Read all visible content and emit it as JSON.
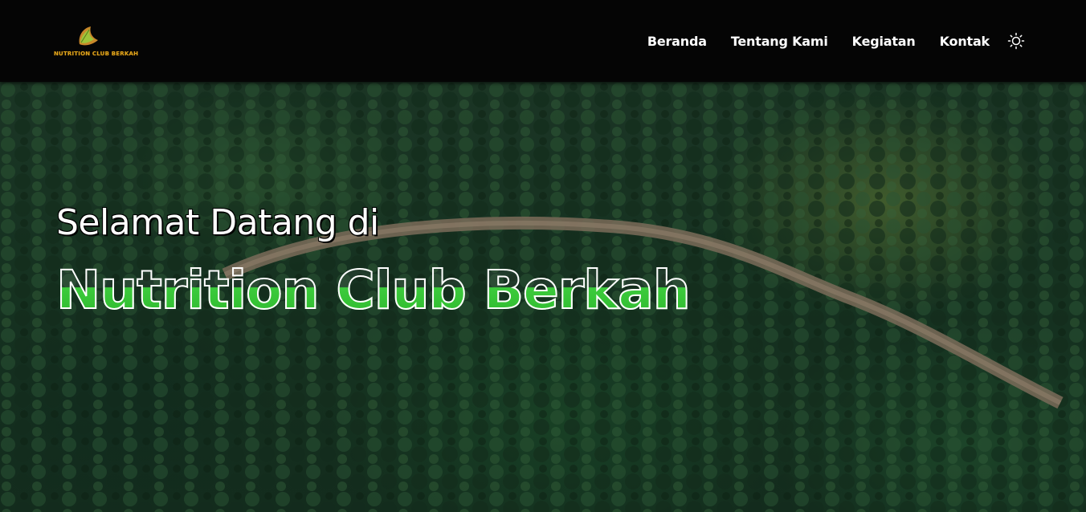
{
  "nav": {
    "logo_text": "NUTRITION CLUB BERKAH",
    "links": [
      "Beranda",
      "Tentang Kami",
      "Kegiatan",
      "Kontak"
    ],
    "theme_icon": "sun-icon"
  },
  "hero": {
    "subtitle": "Selamat Datang di",
    "title": "Nutrition Club Berkah",
    "accent_color": "#3ccb3c"
  }
}
